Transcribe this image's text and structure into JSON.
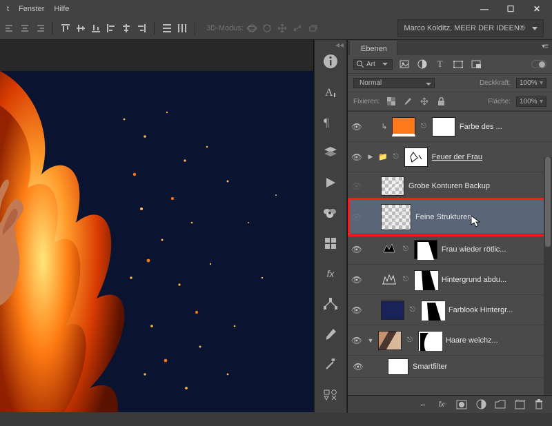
{
  "menu": {
    "items": [
      "t",
      "Fenster",
      "Hilfe"
    ]
  },
  "toolbar": {
    "mode3d_label": "3D-Modus:",
    "credit": "Marco Kolditz, MEER DER IDEEN®"
  },
  "panel": {
    "tab": "Ebenen",
    "kind_label": "Art",
    "blend_mode": "Normal",
    "opacity_label": "Deckkraft:",
    "opacity_value": "100%",
    "lock_label": "Fixieren:",
    "fill_label": "Fläche:",
    "fill_value": "100%"
  },
  "layers": [
    {
      "name": "Farbe des ...",
      "visible": true,
      "thumbA": "orange",
      "mask": "white"
    },
    {
      "name": "Feuer der Frau",
      "visible": true,
      "group": true,
      "expand": "▶",
      "thumbA": "group",
      "underline": true
    },
    {
      "name": "Grobe Konturen Backup",
      "visible": false,
      "thumbA": "checker-grobe"
    },
    {
      "name": "Feine Strukturen",
      "visible": false,
      "selected": true,
      "thumbA": "checker-feine"
    },
    {
      "name": "Frau wieder rötlic...",
      "visible": true,
      "blend_icon": "levels",
      "mask": "frau"
    },
    {
      "name": "Hintergrund abdu...",
      "visible": true,
      "blend_icon": "crown",
      "mask": "hint"
    },
    {
      "name": "Farblook Hintergr...",
      "visible": true,
      "thumbA": "navy",
      "mask": "farb"
    },
    {
      "name": "Haare weichz...",
      "visible": true,
      "thumbA": "photo",
      "mask": "haare",
      "smart": true
    },
    {
      "name": "Smartfilter",
      "visible": true,
      "sf": true
    }
  ],
  "bottom_icons": [
    "link",
    "fx",
    "mask",
    "adjust",
    "group",
    "new",
    "trash"
  ]
}
